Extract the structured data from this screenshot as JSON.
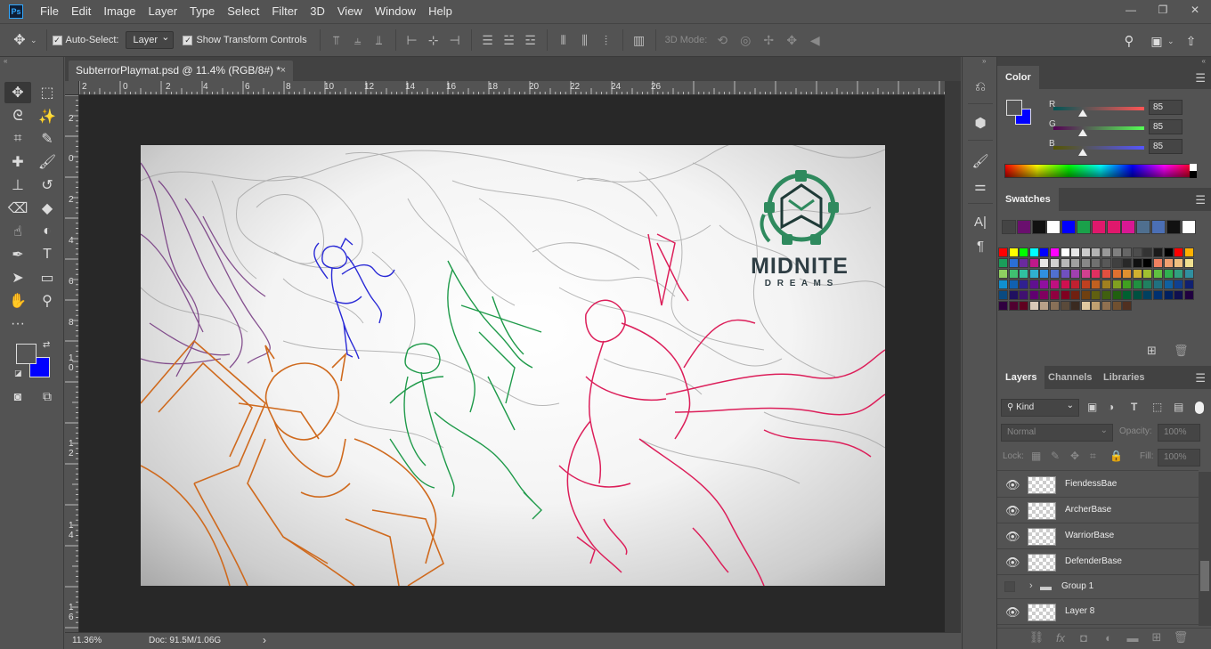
{
  "menu": {
    "app_icon": "Ps",
    "items": [
      "File",
      "Edit",
      "Image",
      "Layer",
      "Type",
      "Select",
      "Filter",
      "3D",
      "View",
      "Window",
      "Help"
    ]
  },
  "window_controls": [
    "minimize-icon",
    "restore-icon",
    "close-icon"
  ],
  "options_bar": {
    "auto_select_label": "Auto-Select:",
    "auto_select_target": "Layer",
    "show_transform_label": "Show Transform Controls",
    "mode_3d_label": "3D Mode:"
  },
  "document": {
    "tab_title": "SubterrorPlaymat.psd @ 11.4% (RGB/8#) *",
    "close_glyph": "×",
    "ruler_top_labels": [
      "2",
      "0",
      "2",
      "4",
      "6",
      "8",
      "10",
      "12",
      "14",
      "16",
      "18",
      "20",
      "22",
      "24",
      "26"
    ],
    "ruler_left_labels": [
      "2",
      "0",
      "2",
      "4",
      "6",
      "8",
      "1\n0",
      "1\n2",
      "1\n4",
      "1\n6"
    ],
    "artwork_logo_top": "MIDNITE",
    "artwork_logo_bottom": "D R E A M S"
  },
  "status": {
    "zoom": "11.36%",
    "doc_info": "Doc: 91.5M/1.06G",
    "arrow": "›"
  },
  "color_panel": {
    "title": "Color",
    "r_label": "R",
    "g_label": "G",
    "b_label": "B",
    "r_value": "85",
    "g_value": "85",
    "b_value": "85",
    "fg_color": "#555555",
    "bg_color": "#0000ff"
  },
  "swatches_panel": {
    "title": "Swatches"
  },
  "layers_panel": {
    "tabs": [
      "Layers",
      "Channels",
      "Libraries"
    ],
    "filter_kind": "Kind",
    "blend_mode": "Normal",
    "opacity_label": "Opacity:",
    "opacity_value": "100%",
    "lock_label": "Lock:",
    "fill_label": "Fill:",
    "fill_value": "100%",
    "layers": [
      {
        "name": "FiendessBae",
        "visible": true,
        "type": "layer"
      },
      {
        "name": "ArcherBase",
        "visible": true,
        "type": "layer"
      },
      {
        "name": "WarriorBase",
        "visible": true,
        "type": "layer"
      },
      {
        "name": "DefenderBase",
        "visible": true,
        "type": "layer"
      },
      {
        "name": "Group 1",
        "visible": false,
        "type": "group"
      },
      {
        "name": "Layer 8",
        "visible": true,
        "type": "layer"
      }
    ]
  }
}
